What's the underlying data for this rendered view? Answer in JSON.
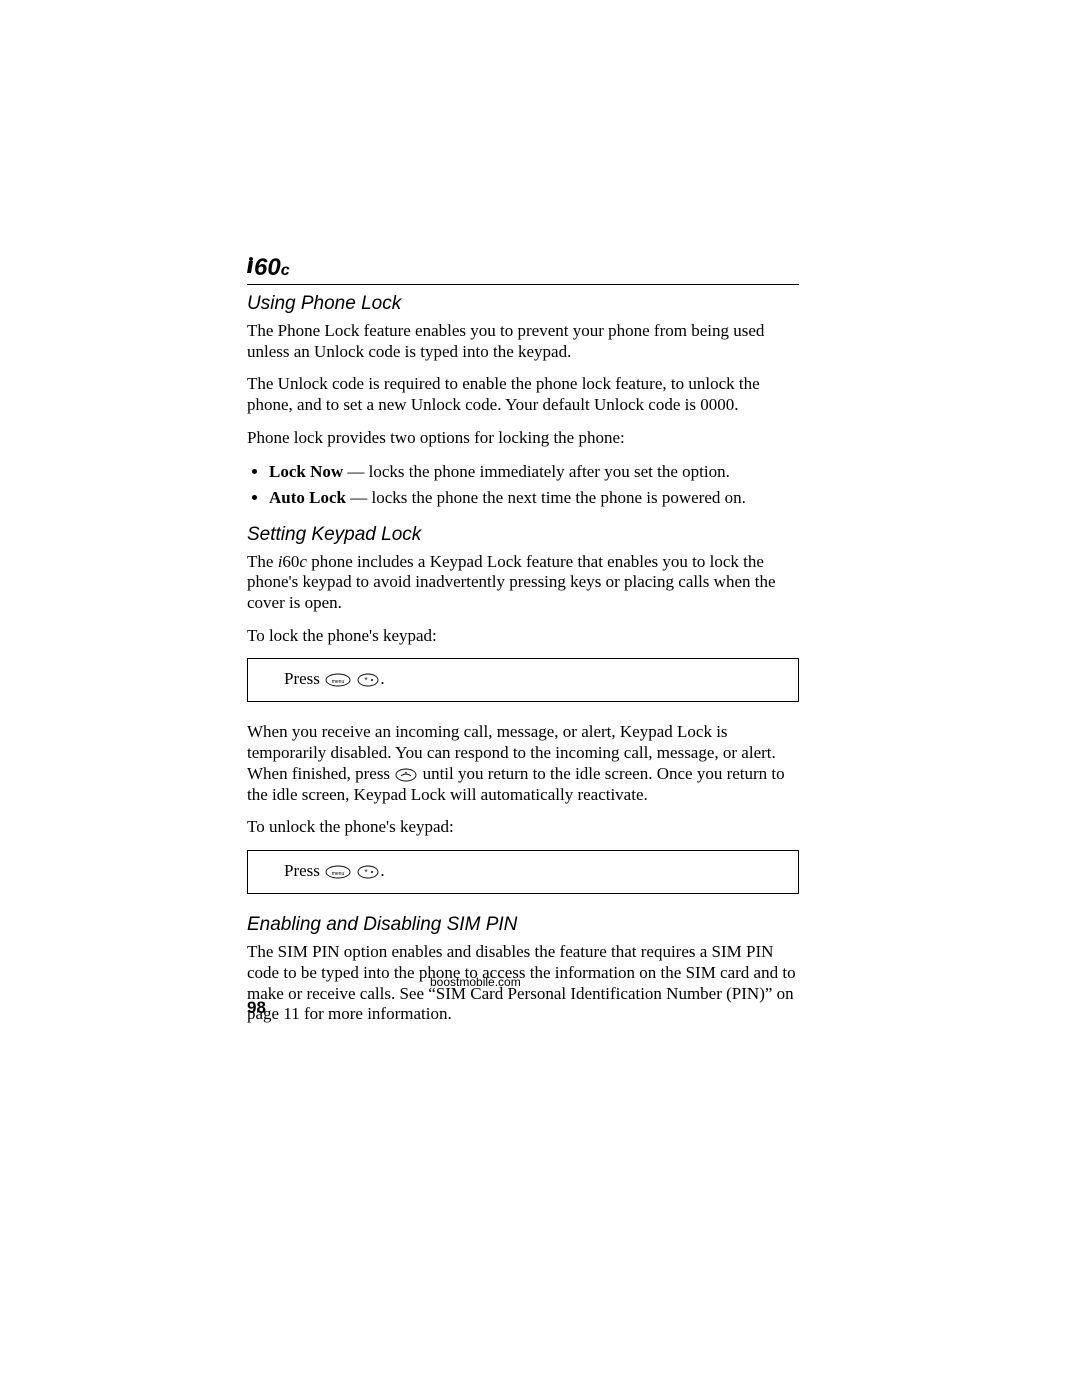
{
  "logo": {
    "prefix": "60",
    "suffix": "c"
  },
  "section1": {
    "heading": "Using Phone Lock",
    "p1": "The Phone Lock feature enables you to prevent your phone from being used unless an Unlock code is typed into the keypad.",
    "p2": "The Unlock code is required to enable the phone lock feature, to unlock the phone, and to set a new Unlock code. Your default Unlock code is 0000.",
    "p3": "Phone lock provides two options for locking the phone:",
    "bullet1_bold": "Lock Now",
    "bullet1_rest": " — locks the phone immediately after you set the option.",
    "bullet2_bold": "Auto Lock",
    "bullet2_rest": " — locks the phone the next time the phone is powered on."
  },
  "section2": {
    "heading": "Setting Keypad Lock",
    "p1_pre": "The ",
    "p1_model_i": "i",
    "p1_model_rest": "60",
    "p1_model_c": "c",
    "p1_post": " phone includes a Keypad Lock feature that enables you to lock the phone's keypad to avoid inadvertently pressing keys or placing calls when the cover is open.",
    "p2": "To lock the phone's keypad:",
    "box1": "Press ",
    "p3_a": "When you receive an incoming call, message, or alert, Keypad Lock is temporarily disabled. You can respond to the incoming call, message, or alert. When finished, press ",
    "p3_b": " until you return to the idle screen. Once you return to the idle screen, Keypad Lock will automatically reactivate.",
    "p4": "To unlock the phone's keypad:",
    "box2": "Press "
  },
  "section3": {
    "heading": "Enabling and Disabling SIM PIN",
    "p1": "The SIM PIN option enables and disables the feature that requires a SIM PIN code to be typed into the phone to access the information on the SIM card and to make or receive calls. See “SIM Card Personal Identification Number (PIN)” on page 11 for more information."
  },
  "footer": {
    "site": "boostmobile.com",
    "page": "98"
  },
  "icons": {
    "menu_key": "menu-key-icon",
    "star_key": "star-key-icon",
    "end_key": "end-key-icon"
  }
}
